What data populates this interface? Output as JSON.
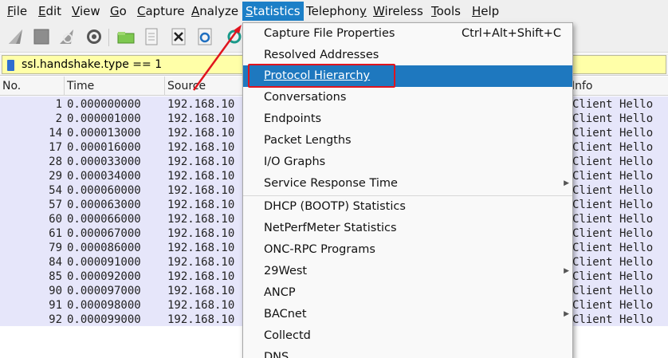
{
  "menubar": {
    "items": [
      {
        "label": "File",
        "mnemonic": "F",
        "rest": "ile"
      },
      {
        "label": "Edit",
        "mnemonic": "E",
        "rest": "dit"
      },
      {
        "label": "View",
        "mnemonic": "V",
        "rest": "iew"
      },
      {
        "label": "Go",
        "mnemonic": "G",
        "rest": "o"
      },
      {
        "label": "Capture",
        "mnemonic": "C",
        "rest": "apture"
      },
      {
        "label": "Analyze",
        "mnemonic": "A",
        "rest": "nalyze"
      },
      {
        "label": "Statistics",
        "mnemonic": "S",
        "rest": "tatistics"
      },
      {
        "label": "Telephony",
        "pre": "Telephon",
        "mnemonic": "y",
        "rest": ""
      },
      {
        "label": "Wireless",
        "mnemonic": "W",
        "rest": "ireless"
      },
      {
        "label": "Tools",
        "mnemonic": "T",
        "rest": "ools"
      },
      {
        "label": "Help",
        "mnemonic": "H",
        "rest": "elp"
      }
    ]
  },
  "toolbar": {
    "icons": [
      "shark-fin-start-icon",
      "stop-square-icon",
      "restart-fin-icon",
      "gear-options-icon",
      "open-folder-icon",
      "document-icon",
      "close-file-icon",
      "reload-icon",
      "find-icon"
    ]
  },
  "filter": {
    "value": "ssl.handshake.type == 1"
  },
  "columns": {
    "no": "No.",
    "time": "Time",
    "source": "Source",
    "info": "Info"
  },
  "packets": [
    {
      "no": "1",
      "time": "0.000000000",
      "source": "192.168.10",
      "info": "Client Hello"
    },
    {
      "no": "2",
      "time": "0.000001000",
      "source": "192.168.10",
      "info": "Client Hello"
    },
    {
      "no": "14",
      "time": "0.000013000",
      "source": "192.168.10",
      "info": "Client Hello"
    },
    {
      "no": "17",
      "time": "0.000016000",
      "source": "192.168.10",
      "info": "Client Hello"
    },
    {
      "no": "28",
      "time": "0.000033000",
      "source": "192.168.10",
      "info": "Client Hello"
    },
    {
      "no": "29",
      "time": "0.000034000",
      "source": "192.168.10",
      "info": "Client Hello"
    },
    {
      "no": "54",
      "time": "0.000060000",
      "source": "192.168.10",
      "info": "Client Hello"
    },
    {
      "no": "57",
      "time": "0.000063000",
      "source": "192.168.10",
      "info": "Client Hello"
    },
    {
      "no": "60",
      "time": "0.000066000",
      "source": "192.168.10",
      "info": "Client Hello"
    },
    {
      "no": "61",
      "time": "0.000067000",
      "source": "192.168.10",
      "info": "Client Hello"
    },
    {
      "no": "79",
      "time": "0.000086000",
      "source": "192.168.10",
      "info": "Client Hello"
    },
    {
      "no": "84",
      "time": "0.000091000",
      "source": "192.168.10",
      "info": "Client Hello"
    },
    {
      "no": "85",
      "time": "0.000092000",
      "source": "192.168.10",
      "info": "Client Hello"
    },
    {
      "no": "90",
      "time": "0.000097000",
      "source": "192.168.10",
      "info": "Client Hello"
    },
    {
      "no": "91",
      "time": "0.000098000",
      "source": "192.168.10",
      "info": "Client Hello"
    },
    {
      "no": "92",
      "time": "0.000099000",
      "source": "192.168.10",
      "info": "Client Hello"
    }
  ],
  "statistics_menu": {
    "items": [
      {
        "label": "Capture File Properties",
        "shortcut": "Ctrl+Alt+Shift+C"
      },
      {
        "label": "Resolved Addresses"
      },
      {
        "label": "Protocol Hierarchy",
        "selected": true
      },
      {
        "label": "Conversations"
      },
      {
        "label": "Endpoints"
      },
      {
        "label": "Packet Lengths"
      },
      {
        "label": "I/O Graphs"
      },
      {
        "label": "Service Response Time",
        "submenu": true
      },
      {
        "label": "DHCP (BOOTP) Statistics"
      },
      {
        "label": "NetPerfMeter Statistics"
      },
      {
        "label": "ONC-RPC Programs"
      },
      {
        "label": "29West",
        "submenu": true
      },
      {
        "label": "ANCP"
      },
      {
        "label": "BACnet",
        "submenu": true
      },
      {
        "label": "Collectd"
      },
      {
        "label": "DNS"
      }
    ]
  },
  "colors": {
    "menu_active": "#1c7fc7",
    "menu_highlight": "#1e78bf",
    "filter_valid": "#ffffa8",
    "row_background": "#e6e6fa",
    "annotation_red": "#e0141e"
  }
}
